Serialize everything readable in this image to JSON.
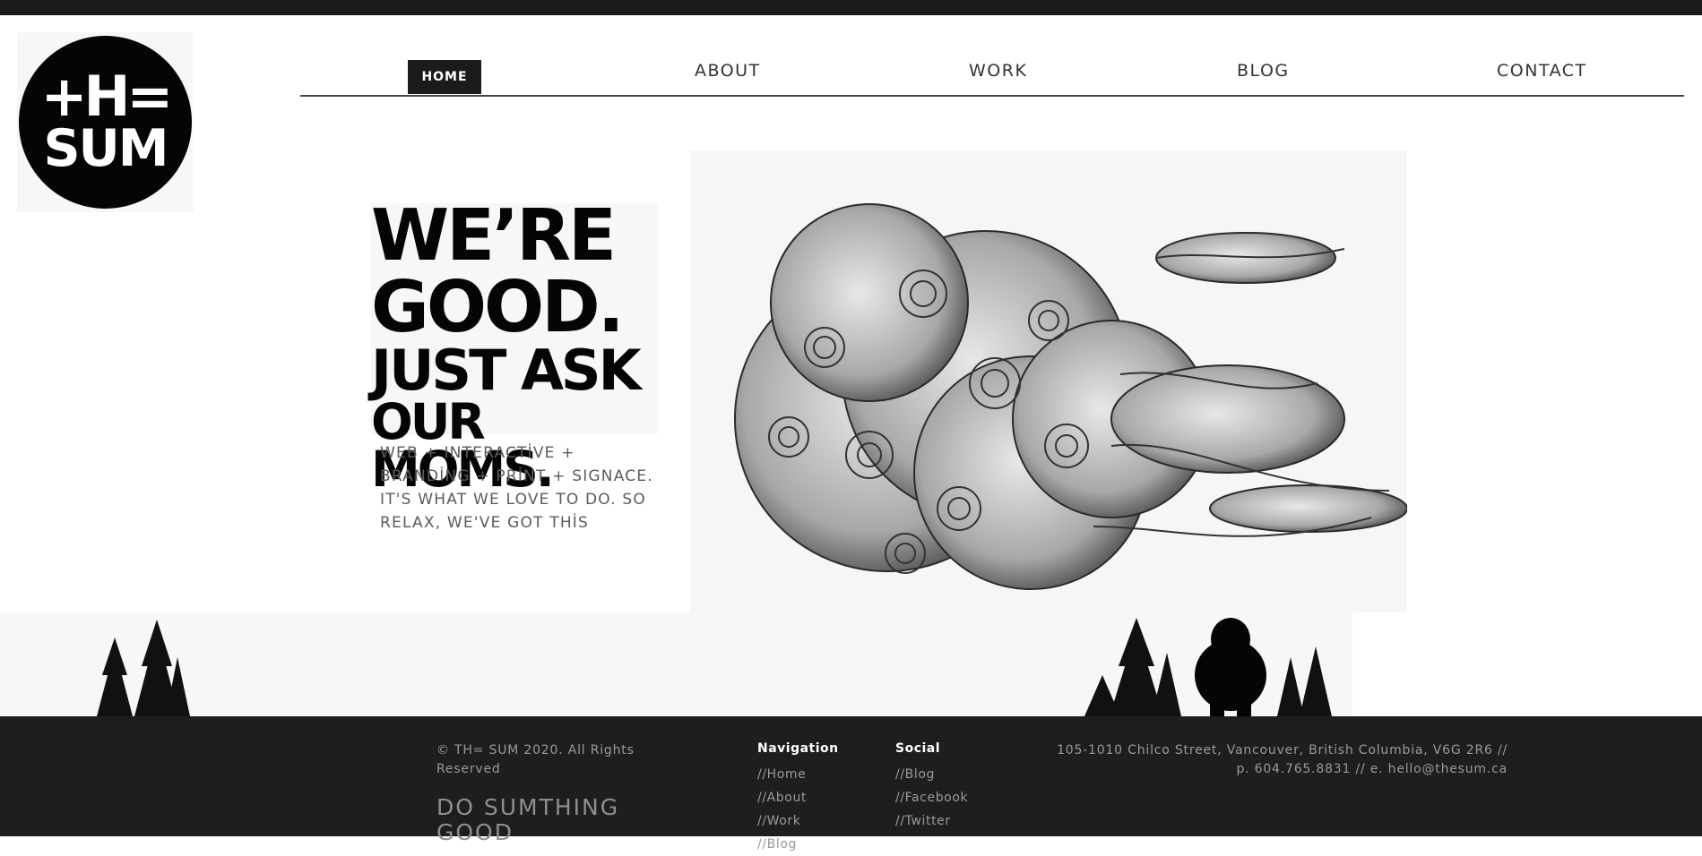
{
  "logo": {
    "line1": "+H=",
    "line2": "SUM"
  },
  "nav": {
    "home": "HOME",
    "about": "ABOUT",
    "work": "WORK",
    "blog": "BLOG",
    "contact": "CONTACT"
  },
  "hero": {
    "line1": "WE’RE",
    "line2": "GOOD.",
    "line3": "JUST ASK",
    "line4": "OUR MOMS.",
    "sub1": "WEB + INTERACTİVE +",
    "sub2": "BRANDİNG + PRİNT + SIGNACE.",
    "sub3": "IT'S WHAT WE LOVE TO DO. SO",
    "sub4": "RELAX, WE'VE GOT THİS"
  },
  "footer": {
    "copyright": "© TH= SUM 2020. All Rights Reserved",
    "slogan": "DO SUMTHING GOOD",
    "nav_title": "Navigation",
    "nav_links": [
      "//Home",
      "//About",
      "//Work",
      "//Blog"
    ],
    "social_title": "Social",
    "social_links": [
      "//Blog",
      "//Facebook",
      "//Twitter"
    ],
    "address": "105-1010 Chilco Street, Vancouver, British Columbia, V6G 2R6 // p. 604.765.8831 // e. hello@thesum.ca"
  },
  "colors": {
    "dark": "#1b1b1b",
    "footer_bg": "#1e1e1e",
    "muted_text": "#9a9a9a"
  },
  "icons": [
    "thesum-logo",
    "wind-cloud-illustration",
    "pine-trees-silhouette",
    "sasquatch-silhouette"
  ]
}
